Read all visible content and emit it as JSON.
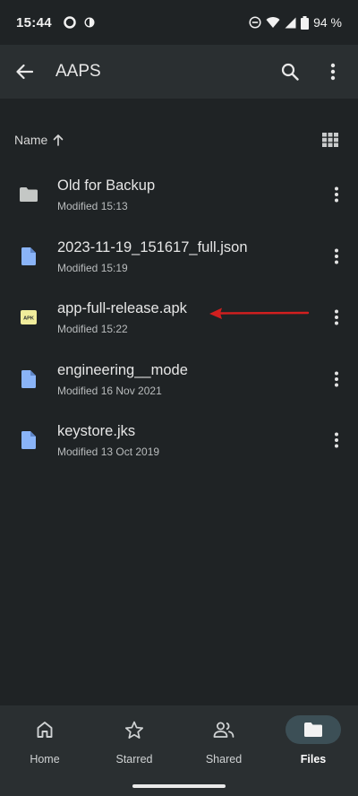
{
  "status": {
    "time": "15:44",
    "battery": "94 %",
    "icons": [
      "ring-icon",
      "half-circle-icon",
      "dnd-icon",
      "wifi-icon",
      "signal-icon",
      "battery-icon"
    ]
  },
  "app_bar": {
    "title": "AAPS",
    "icons": [
      "back-arrow-icon",
      "search-icon",
      "more-vert-icon"
    ]
  },
  "sort": {
    "label": "Name",
    "direction_icon": "arrow-up-icon",
    "view_toggle_icon": "grid-view-icon"
  },
  "files": [
    {
      "name": "Old for Backup",
      "meta": "Modified 15:13",
      "icon": "folder-icon"
    },
    {
      "name": "2023-11-19_151617_full.json",
      "meta": "Modified 15:19",
      "icon": "document-icon"
    },
    {
      "name": "app-full-release.apk",
      "meta": "Modified 15:22",
      "icon": "apk-icon",
      "icon_text": "APK"
    },
    {
      "name": "engineering__mode",
      "meta": "Modified 16 Nov 2021",
      "icon": "document-icon"
    },
    {
      "name": "keystore.jks",
      "meta": "Modified 13 Oct 2019",
      "icon": "document-icon"
    }
  ],
  "bottom_nav": [
    {
      "label": "Home",
      "icon": "home-icon",
      "active": false
    },
    {
      "label": "Starred",
      "icon": "star-icon",
      "active": false
    },
    {
      "label": "Shared",
      "icon": "people-icon",
      "active": false
    },
    {
      "label": "Files",
      "icon": "folder-icon",
      "active": true
    }
  ],
  "colors": {
    "background": "#1f2325",
    "app_bar": "#2a2f31",
    "document_icon": "#8ab4f8",
    "folder_icon": "#c4c7c5",
    "apk_icon": "#f0ec9b",
    "annotation_arrow": "#d21f1f",
    "nav_active": "#3c4f56"
  }
}
